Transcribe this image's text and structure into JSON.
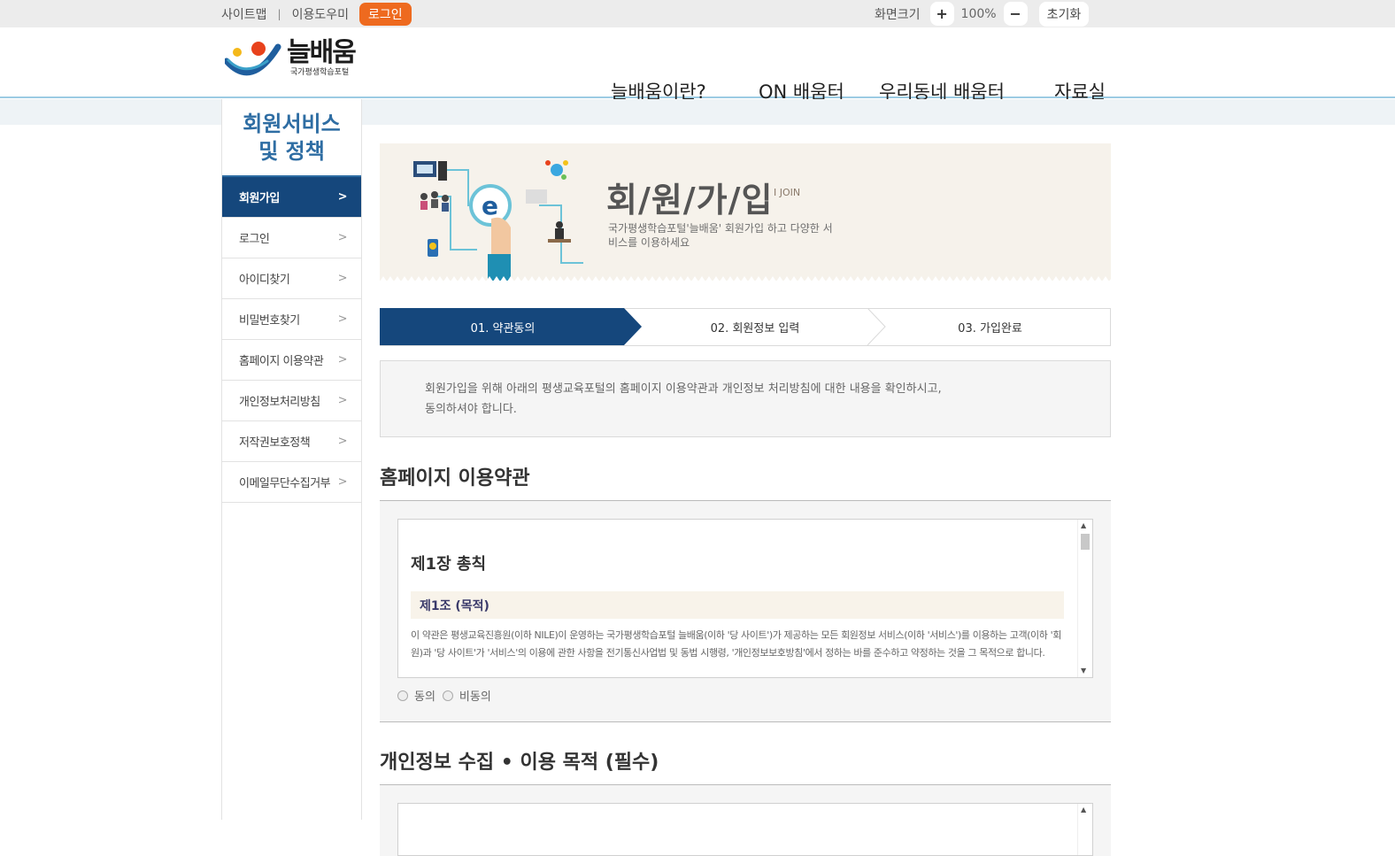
{
  "topbar": {
    "sitemap": "사이트맵",
    "separator": "|",
    "guide": "이용도우미",
    "login": "로그인",
    "zoom_label": "화면크기",
    "zoom_in": "+",
    "zoom_value": "100%",
    "zoom_out": "−",
    "reset": "초기화"
  },
  "logo": {
    "name": "늘배움",
    "sub": "국가평생학습포털"
  },
  "gnb": [
    {
      "label": "늘배움이란?"
    },
    {
      "label": "ON 배움터"
    },
    {
      "label": "우리동네 배움터"
    },
    {
      "label": "자료실"
    }
  ],
  "sidebar": {
    "title": "회원서비스 및 정책",
    "items": [
      {
        "label": "회원가입",
        "active": true
      },
      {
        "label": "로그인"
      },
      {
        "label": "아이디찾기"
      },
      {
        "label": "비밀번호찾기"
      },
      {
        "label": "홈페이지 이용약관"
      },
      {
        "label": "개인정보처리방침"
      },
      {
        "label": "저작권보호정책"
      },
      {
        "label": "이메일무단수집거부"
      }
    ]
  },
  "banner": {
    "title": "회/원/가/입",
    "sub": "I   JOIN",
    "desc": "국가평생학습포털'늘배움' 회원가입 하고 다양한 서비스를 이용하세요"
  },
  "steps": [
    {
      "label": "01. 약관동의",
      "active": true
    },
    {
      "label": "02. 회원정보 입력"
    },
    {
      "label": "03. 가입완료"
    }
  ],
  "notice": {
    "line1": "회원가입을 위해 아래의 평생교육포털의 홈페이지 이용약관과 개인정보 처리방침에 대한 내용을 확인하시고,",
    "line2": "동의하셔야 합니다."
  },
  "terms": {
    "title": "홈페이지 이용약관",
    "chapter": "제1장 총칙",
    "article": "제1조 (목적)",
    "text": "이 약관은 평생교육진흥원(이하 NILE)이 운영하는 국가평생학습포털 늘배움(이하 '당 사이트')가 제공하는 모든 회원정보 서비스(이하 '서비스')를 이용하는 고객(이하 '회원)과 '당 사이트'가 '서비스'의 이용에 관한 사항을 전기통신사업법 및 동법 시행령, '개인정보보호방침'에서 정하는 바를 준수하고 약정하는 것을 그 목적으로 합니다.",
    "agree": "동의",
    "disagree": "비동의"
  },
  "privacy": {
    "title": "개인정보 수집 • 이용 목적 (필수)"
  },
  "colors": {
    "brand_blue": "#15477c",
    "accent_orange": "#ee6a1f",
    "title_blue": "#2e6da3"
  }
}
